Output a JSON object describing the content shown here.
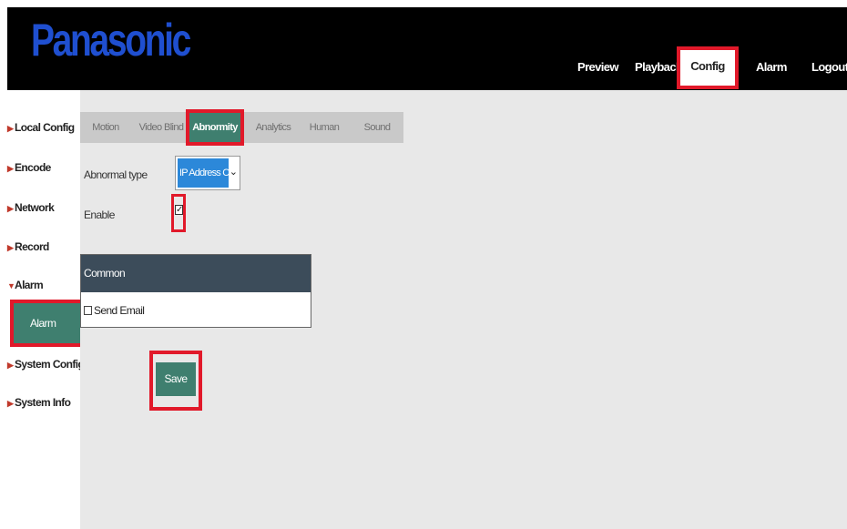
{
  "brand": {
    "logo_text": "Panasonic"
  },
  "top_nav": [
    "Preview",
    "Playback",
    "Config",
    "Alarm",
    "Logout"
  ],
  "top_nav_active": "Config",
  "sidebar": {
    "items": [
      {
        "label": "Local Config"
      },
      {
        "label": "Encode"
      },
      {
        "label": "Network"
      },
      {
        "label": "Record"
      },
      {
        "label": "Alarm"
      },
      {
        "label": "System Config"
      },
      {
        "label": "System Info"
      }
    ],
    "sub_items": [
      {
        "label": "Alarm"
      }
    ]
  },
  "tabs": [
    "Motion",
    "Video Blind",
    "Abnormity",
    "Analytics",
    "Human",
    "Sound"
  ],
  "active_tab": "Abnormity",
  "form": {
    "abnormal_type_label": "Abnormal type",
    "abnormal_type_value": "IP Address Conflict",
    "enable_label": "Enable",
    "enable_checked": true
  },
  "common": {
    "header": "Common",
    "send_email_label": "Send Email",
    "send_email_checked": false
  },
  "save_label": "Save",
  "colors": {
    "accent": "#3f7f6f",
    "highlight": "#e1192a",
    "logo": "#1f4fd0",
    "select": "#2c88d9"
  }
}
